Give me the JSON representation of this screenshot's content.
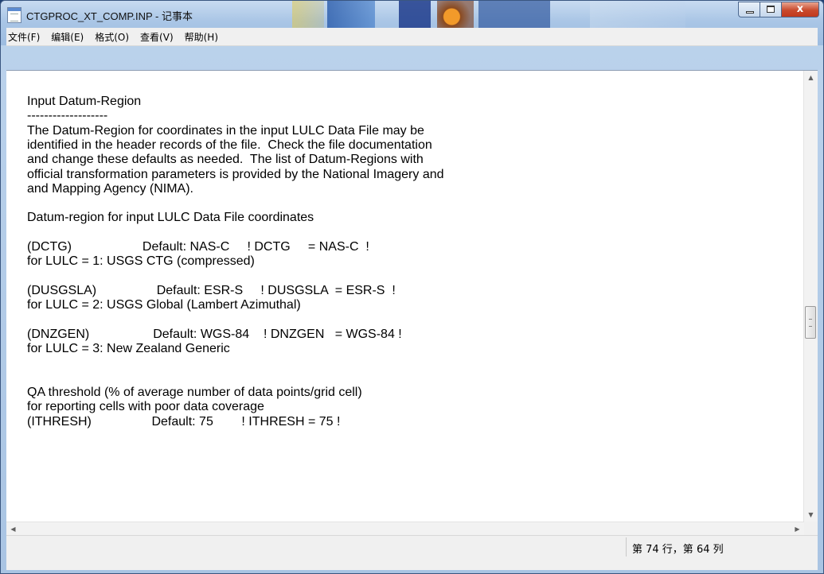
{
  "window": {
    "title": "CTGPROC_XT_COMP.INP - 记事本",
    "minimize_glyph": "",
    "maximize_glyph": "",
    "close_glyph": "x"
  },
  "menu": {
    "items": [
      {
        "label": "文件(F)"
      },
      {
        "label": "编辑(E)"
      },
      {
        "label": "格式(O)"
      },
      {
        "label": "查看(V)"
      },
      {
        "label": "帮助(H)"
      }
    ]
  },
  "document": {
    "lines": [
      "Input Datum-Region",
      "-------------------",
      "The Datum-Region for coordinates in the input LULC Data File may be",
      "identified in the header records of the file.  Check the file documentation",
      "and change these defaults as needed.  The list of Datum-Regions with",
      "official transformation parameters is provided by the National Imagery and",
      "and Mapping Agency (NIMA).",
      "",
      "Datum-region for input LULC Data File coordinates",
      "",
      "(DCTG)                    Default: NAS-C     ! DCTG     = NAS-C  !",
      "for LULC = 1: USGS CTG (compressed)",
      "",
      "(DUSGSLA)                 Default: ESR-S     ! DUSGSLA  = ESR-S  !",
      "for LULC = 2: USGS Global (Lambert Azimuthal)",
      "",
      "(DNZGEN)                  Default: WGS-84    ! DNZGEN   = WGS-84 !",
      "for LULC = 3: New Zealand Generic",
      "",
      "",
      "QA threshold (% of average number of data points/grid cell)",
      "for reporting cells with poor data coverage",
      "(ITHRESH)                 Default: 75        ! ITHRESH = 75 !"
    ]
  },
  "status": {
    "position": "第 74 行，第 64 列"
  },
  "colors": {
    "titlebar": "#aac6e6",
    "editor_bg": "#ffffff",
    "close_button": "#c94a2d"
  }
}
